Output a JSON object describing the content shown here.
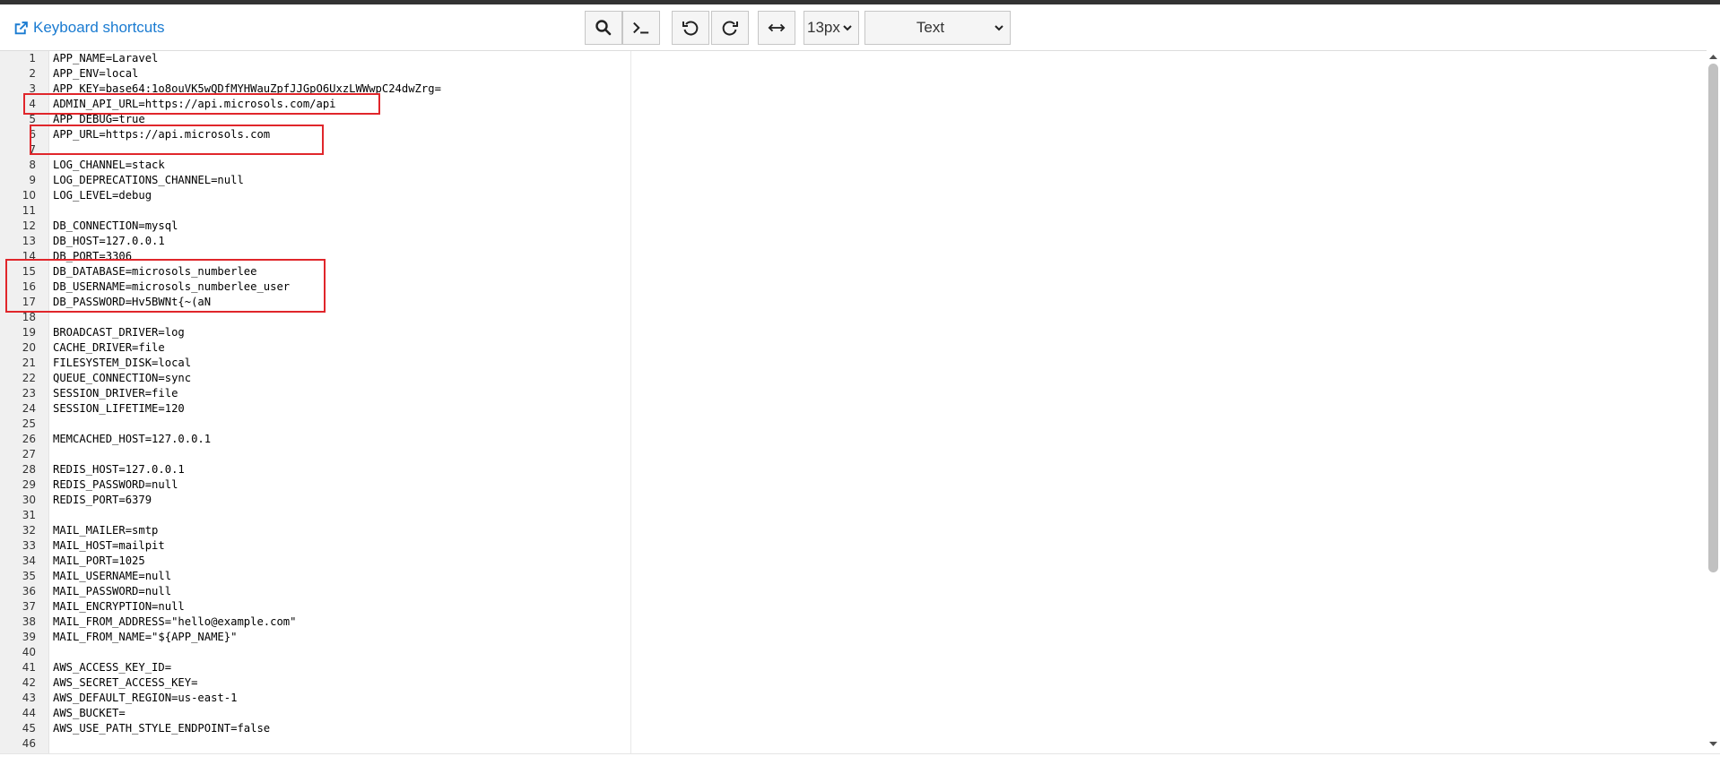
{
  "toolbar": {
    "shortcuts_label": "Keyboard shortcuts",
    "font_size": "13px",
    "mode": "Text"
  },
  "lines": [
    {
      "n": "1",
      "text": "APP_NAME=Laravel"
    },
    {
      "n": "2",
      "text": "APP_ENV=local"
    },
    {
      "n": "3",
      "text": "APP_KEY=base64:1o8ouVK5wQDfMYHWauZpfJJGpO6UxzLWWwpC24dwZrg="
    },
    {
      "n": "4",
      "text": "ADMIN_API_URL=https://api.microsols.com/api"
    },
    {
      "n": "5",
      "text": "APP_DEBUG=true"
    },
    {
      "n": "6",
      "text": "APP_URL=https://api.microsols.com"
    },
    {
      "n": "7",
      "text": ""
    },
    {
      "n": "8",
      "text": "LOG_CHANNEL=stack"
    },
    {
      "n": "9",
      "text": "LOG_DEPRECATIONS_CHANNEL=null"
    },
    {
      "n": "10",
      "text": "LOG_LEVEL=debug"
    },
    {
      "n": "11",
      "text": ""
    },
    {
      "n": "12",
      "text": "DB_CONNECTION=mysql"
    },
    {
      "n": "13",
      "text": "DB_HOST=127.0.0.1"
    },
    {
      "n": "14",
      "text": "DB_PORT=3306"
    },
    {
      "n": "15",
      "text": "DB_DATABASE=microsols_numberlee"
    },
    {
      "n": "16",
      "text": "DB_USERNAME=microsols_numberlee_user"
    },
    {
      "n": "17",
      "text": "DB_PASSWORD=Hv5BWNt{~(aN"
    },
    {
      "n": "18",
      "text": ""
    },
    {
      "n": "19",
      "text": "BROADCAST_DRIVER=log"
    },
    {
      "n": "20",
      "text": "CACHE_DRIVER=file"
    },
    {
      "n": "21",
      "text": "FILESYSTEM_DISK=local"
    },
    {
      "n": "22",
      "text": "QUEUE_CONNECTION=sync"
    },
    {
      "n": "23",
      "text": "SESSION_DRIVER=file"
    },
    {
      "n": "24",
      "text": "SESSION_LIFETIME=120"
    },
    {
      "n": "25",
      "text": ""
    },
    {
      "n": "26",
      "text": "MEMCACHED_HOST=127.0.0.1"
    },
    {
      "n": "27",
      "text": ""
    },
    {
      "n": "28",
      "text": "REDIS_HOST=127.0.0.1"
    },
    {
      "n": "29",
      "text": "REDIS_PASSWORD=null"
    },
    {
      "n": "30",
      "text": "REDIS_PORT=6379"
    },
    {
      "n": "31",
      "text": ""
    },
    {
      "n": "32",
      "text": "MAIL_MAILER=smtp"
    },
    {
      "n": "33",
      "text": "MAIL_HOST=mailpit"
    },
    {
      "n": "34",
      "text": "MAIL_PORT=1025"
    },
    {
      "n": "35",
      "text": "MAIL_USERNAME=null"
    },
    {
      "n": "36",
      "text": "MAIL_PASSWORD=null"
    },
    {
      "n": "37",
      "text": "MAIL_ENCRYPTION=null"
    },
    {
      "n": "38",
      "text": "MAIL_FROM_ADDRESS=\"hello@example.com\""
    },
    {
      "n": "39",
      "text": "MAIL_FROM_NAME=\"${APP_NAME}\""
    },
    {
      "n": "40",
      "text": ""
    },
    {
      "n": "41",
      "text": "AWS_ACCESS_KEY_ID="
    },
    {
      "n": "42",
      "text": "AWS_SECRET_ACCESS_KEY="
    },
    {
      "n": "43",
      "text": "AWS_DEFAULT_REGION=us-east-1"
    },
    {
      "n": "44",
      "text": "AWS_BUCKET="
    },
    {
      "n": "45",
      "text": "AWS_USE_PATH_STYLE_ENDPOINT=false"
    },
    {
      "n": "46",
      "text": ""
    }
  ],
  "colors": {
    "highlight": "#e0262b",
    "link": "#1a7bd1"
  }
}
